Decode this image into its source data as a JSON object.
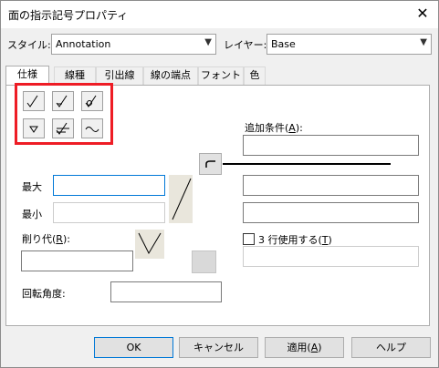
{
  "window": {
    "title": "面の指示記号プロパティ",
    "close_glyph": "✕"
  },
  "header": {
    "style_label": "スタイル:",
    "style_value": "Annotation",
    "layer_label": "レイヤー:",
    "layer_value": "Base"
  },
  "tabs": [
    {
      "label": "仕様",
      "active": true
    },
    {
      "label": "線種"
    },
    {
      "label": "引出線"
    },
    {
      "label": "線の端点"
    },
    {
      "label": "フォント"
    },
    {
      "label": "色"
    }
  ],
  "symbols": [
    {
      "name": "basic-surface-symbol-icon"
    },
    {
      "name": "machining-required-symbol-icon"
    },
    {
      "name": "machining-prohibited-symbol-icon"
    },
    {
      "name": "triangle-symbol-icon"
    },
    {
      "name": "multi-stroke-symbol-icon"
    },
    {
      "name": "wave-symbol-icon"
    }
  ],
  "fields": {
    "max_label": "最大",
    "min_label": "最小",
    "allowance_label": "削り代(R):",
    "allowance_accel": "R",
    "rotation_label": "回転角度:",
    "additional_label": "追加条件(A):",
    "additional_accel": "A",
    "three_lines_label": "3 行使用する(T)",
    "three_lines_accel": "T",
    "three_lines_checked": false
  },
  "buttons": {
    "ok": "OK",
    "cancel": "キャンセル",
    "apply": "適用(A)",
    "help": "ヘルプ"
  },
  "colors": {
    "highlight": "#ee1c25",
    "focus": "#0078d7"
  }
}
